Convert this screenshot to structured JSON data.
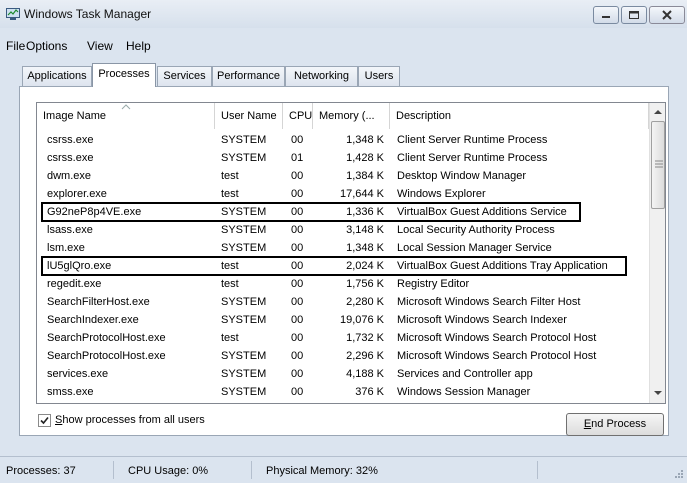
{
  "window": {
    "title": "Windows Task Manager"
  },
  "menu": [
    "File",
    "Options",
    "View",
    "Help"
  ],
  "tabs": [
    {
      "label": "Applications",
      "active": false
    },
    {
      "label": "Processes",
      "active": true
    },
    {
      "label": "Services",
      "active": false
    },
    {
      "label": "Performance",
      "active": false
    },
    {
      "label": "Networking",
      "active": false
    },
    {
      "label": "Users",
      "active": false
    }
  ],
  "columns": [
    "Image Name",
    "User Name",
    "CPU",
    "Memory (...",
    "Description"
  ],
  "processes": [
    {
      "name": "csrss.exe",
      "user": "SYSTEM",
      "cpu": "00",
      "memory": "1,348 K",
      "description": "Client Server Runtime Process",
      "highlighted": false
    },
    {
      "name": "csrss.exe",
      "user": "SYSTEM",
      "cpu": "01",
      "memory": "1,428 K",
      "description": "Client Server Runtime Process",
      "highlighted": false
    },
    {
      "name": "dwm.exe",
      "user": "test",
      "cpu": "00",
      "memory": "1,384 K",
      "description": "Desktop Window Manager",
      "highlighted": false
    },
    {
      "name": "explorer.exe",
      "user": "test",
      "cpu": "00",
      "memory": "17,644 K",
      "description": "Windows Explorer",
      "highlighted": false
    },
    {
      "name": "G92neP8p4VE.exe",
      "user": "SYSTEM",
      "cpu": "00",
      "memory": "1,336 K",
      "description": "VirtualBox Guest Additions Service",
      "highlighted": true
    },
    {
      "name": "lsass.exe",
      "user": "SYSTEM",
      "cpu": "00",
      "memory": "3,148 K",
      "description": "Local Security Authority Process",
      "highlighted": false
    },
    {
      "name": "lsm.exe",
      "user": "SYSTEM",
      "cpu": "00",
      "memory": "1,348 K",
      "description": "Local Session Manager Service",
      "highlighted": false
    },
    {
      "name": "lU5glQro.exe",
      "user": "test",
      "cpu": "00",
      "memory": "2,024 K",
      "description": "VirtualBox Guest Additions Tray Application",
      "highlighted": true
    },
    {
      "name": "regedit.exe",
      "user": "test",
      "cpu": "00",
      "memory": "1,756 K",
      "description": "Registry Editor",
      "highlighted": false
    },
    {
      "name": "SearchFilterHost.exe",
      "user": "SYSTEM",
      "cpu": "00",
      "memory": "2,280 K",
      "description": "Microsoft Windows Search Filter Host",
      "highlighted": false
    },
    {
      "name": "SearchIndexer.exe",
      "user": "SYSTEM",
      "cpu": "00",
      "memory": "19,076 K",
      "description": "Microsoft Windows Search Indexer",
      "highlighted": false
    },
    {
      "name": "SearchProtocolHost.exe",
      "user": "test",
      "cpu": "00",
      "memory": "1,732 K",
      "description": "Microsoft Windows Search Protocol Host",
      "highlighted": false
    },
    {
      "name": "SearchProtocolHost.exe",
      "user": "SYSTEM",
      "cpu": "00",
      "memory": "2,296 K",
      "description": "Microsoft Windows Search Protocol Host",
      "highlighted": false
    },
    {
      "name": "services.exe",
      "user": "SYSTEM",
      "cpu": "00",
      "memory": "4,188 K",
      "description": "Services and Controller app",
      "highlighted": false
    },
    {
      "name": "smss.exe",
      "user": "SYSTEM",
      "cpu": "00",
      "memory": "376 K",
      "description": "Windows Session Manager",
      "highlighted": false
    }
  ],
  "show_all_users": {
    "checked": true,
    "label_first": "S",
    "label_rest": "how processes from all users"
  },
  "end_process": {
    "label_first": "E",
    "label_rest": "nd Process"
  },
  "status": {
    "processes": "Processes: 37",
    "cpu_usage": "CPU Usage: 0%",
    "physical_memory": "Physical Memory: 32%"
  }
}
